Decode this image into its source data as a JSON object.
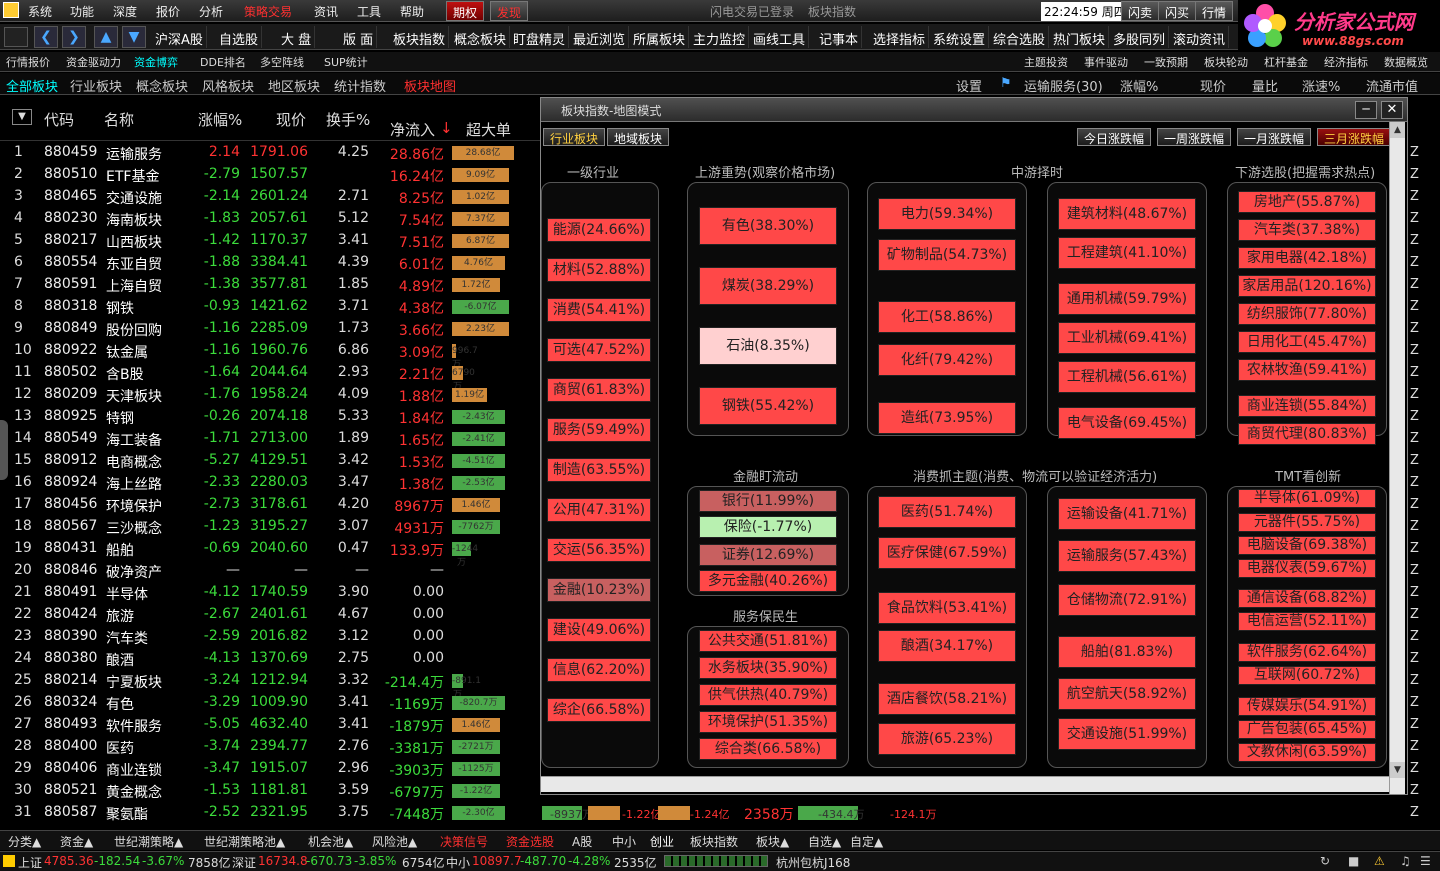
{
  "menu": {
    "items": [
      "系统",
      "功能",
      "深度",
      "报价",
      "分析",
      "策略交易",
      "资讯",
      "工具",
      "帮助"
    ],
    "btn_options": "期权",
    "btn_trade": "发现",
    "status_text": "闪电交易已登录",
    "index_text": "板块指数",
    "clock": "22:24:59 周四",
    "buy": "闪卖",
    "sell": "闪买",
    "quote": "行情"
  },
  "logo": {
    "title": "分析家公式网",
    "url": "www.88gs.com"
  },
  "toolbar1": [
    "沪深A股",
    "自选股",
    "大 盘",
    "版 面",
    "板块指数",
    "概念板块",
    "盯盘精灵",
    "最近浏览",
    "所属板块",
    "主力监控",
    "画线工具",
    "记事本",
    "选择指标",
    "系统设置",
    "综合选股",
    "热门板块",
    "多股同列",
    "滚动资讯"
  ],
  "toolbar2": [
    "行情报价",
    "资金驱动力",
    "资金博弈",
    "DDE排名",
    "多空阵线",
    "SUP统计",
    "主题投资",
    "事件驱动",
    "一致预期",
    "板块轮动",
    "杠杆基金",
    "经济指标",
    "数据概览"
  ],
  "tabs3": {
    "left": [
      "全部板块",
      "行业板块",
      "概念板块",
      "风格板块",
      "地区板块",
      "统计指数",
      "板块地图"
    ],
    "right": [
      "设置",
      "运输服务(30)",
      "涨幅%",
      "现价",
      "量比",
      "涨速%",
      "流通市值"
    ]
  },
  "table": {
    "headers": [
      "代码",
      "名称",
      "涨幅%",
      "现价",
      "换手%",
      "净流入",
      "超大单"
    ],
    "rows": [
      {
        "n": "1",
        "code": "880459",
        "name": "运输服务",
        "chg": "2.14",
        "price": "1791.06",
        "turn": "4.25",
        "flow": "28.86亿",
        "bar": "28.68亿",
        "bv": 0.7,
        "bc": "o"
      },
      {
        "n": "2",
        "code": "880510",
        "name": "ETF基金",
        "chg": "-2.79",
        "price": "1507.57",
        "turn": "",
        "flow": "16.24亿",
        "bar": "9.09亿",
        "bv": 0.65,
        "bc": "o"
      },
      {
        "n": "3",
        "code": "880465",
        "name": "交通设施",
        "chg": "-2.14",
        "price": "2601.24",
        "turn": "2.71",
        "flow": "8.25亿",
        "bar": "1.02亿",
        "bv": 0.65,
        "bc": "o"
      },
      {
        "n": "4",
        "code": "880230",
        "name": "海南板块",
        "chg": "-1.83",
        "price": "2057.61",
        "turn": "5.12",
        "flow": "7.54亿",
        "bar": "7.37亿",
        "bv": 0.65,
        "bc": "o"
      },
      {
        "n": "5",
        "code": "880217",
        "name": "山西板块",
        "chg": "-1.42",
        "price": "1170.37",
        "turn": "3.41",
        "flow": "7.51亿",
        "bar": "6.87亿",
        "bv": 0.65,
        "bc": "o"
      },
      {
        "n": "6",
        "code": "880554",
        "name": "东亚自贸",
        "chg": "-1.88",
        "price": "3384.41",
        "turn": "4.39",
        "flow": "6.01亿",
        "bar": "4.76亿",
        "bv": 0.6,
        "bc": "o"
      },
      {
        "n": "7",
        "code": "880591",
        "name": "上海自贸",
        "chg": "-1.38",
        "price": "3577.81",
        "turn": "1.85",
        "flow": "4.89亿",
        "bar": "1.72亿",
        "bv": 0.55,
        "bc": "o"
      },
      {
        "n": "8",
        "code": "880318",
        "name": "钢铁",
        "chg": "-0.93",
        "price": "1421.62",
        "turn": "3.71",
        "flow": "4.38亿",
        "bar": "-6.07亿",
        "bv": 0.65,
        "bc": "g"
      },
      {
        "n": "9",
        "code": "880849",
        "name": "股份回购",
        "chg": "-1.16",
        "price": "2285.09",
        "turn": "1.73",
        "flow": "3.66亿",
        "bar": "2.23亿",
        "bv": 0.65,
        "bc": "o"
      },
      {
        "n": "10",
        "code": "880922",
        "name": "钛金属",
        "chg": "-1.16",
        "price": "1960.76",
        "turn": "6.86",
        "flow": "3.09亿",
        "bar": "996.7万",
        "bv": 0.03,
        "bc": "o"
      },
      {
        "n": "11",
        "code": "880502",
        "name": "含B股",
        "chg": "-1.64",
        "price": "2044.64",
        "turn": "2.93",
        "flow": "2.21亿",
        "bar": "6790万",
        "bv": 0.12,
        "bc": "o"
      },
      {
        "n": "12",
        "code": "880209",
        "name": "天津板块",
        "chg": "-1.76",
        "price": "1958.24",
        "turn": "4.09",
        "flow": "1.88亿",
        "bar": "1.19亿",
        "bv": 0.4,
        "bc": "o"
      },
      {
        "n": "13",
        "code": "880925",
        "name": "特钢",
        "chg": "-0.26",
        "price": "2074.18",
        "turn": "5.33",
        "flow": "1.84亿",
        "bar": "-2.43亿",
        "bv": 0.6,
        "bc": "g"
      },
      {
        "n": "14",
        "code": "880549",
        "name": "海工装备",
        "chg": "-1.71",
        "price": "2713.00",
        "turn": "1.89",
        "flow": "1.65亿",
        "bar": "-2.41亿",
        "bv": 0.6,
        "bc": "g"
      },
      {
        "n": "15",
        "code": "880912",
        "name": "电商概念",
        "chg": "-5.27",
        "price": "4129.51",
        "turn": "3.42",
        "flow": "1.53亿",
        "bar": "-4.51亿",
        "bv": 0.6,
        "bc": "g"
      },
      {
        "n": "16",
        "code": "880924",
        "name": "海上丝路",
        "chg": "-2.33",
        "price": "2280.03",
        "turn": "3.47",
        "flow": "1.38亿",
        "bar": "-2.53亿",
        "bv": 0.6,
        "bc": "g"
      },
      {
        "n": "17",
        "code": "880456",
        "name": "环境保护",
        "chg": "-2.73",
        "price": "3178.61",
        "turn": "4.20",
        "flow": "8967万",
        "bar": "1.46亿",
        "bv": 0.55,
        "bc": "o"
      },
      {
        "n": "18",
        "code": "880567",
        "name": "三沙概念",
        "chg": "-1.23",
        "price": "3195.27",
        "turn": "3.07",
        "flow": "4931万",
        "bar": "-7762万",
        "bv": 0.55,
        "bc": "g"
      },
      {
        "n": "19",
        "code": "880431",
        "name": "船舶",
        "chg": "-0.69",
        "price": "2040.60",
        "turn": "0.47",
        "flow": "133.9万",
        "bar": "-1244万",
        "bv": 0.22,
        "bc": "g"
      },
      {
        "n": "20",
        "code": "880846",
        "name": "破净资产",
        "chg": "—",
        "price": "—",
        "turn": "—",
        "flow": "—",
        "bar": "",
        "bv": 0,
        "bc": "o"
      },
      {
        "n": "21",
        "code": "880491",
        "name": "半导体",
        "chg": "-4.12",
        "price": "1740.59",
        "turn": "3.90",
        "flow": "0.00",
        "bar": "",
        "bv": 0,
        "bc": "o"
      },
      {
        "n": "22",
        "code": "880424",
        "name": "旅游",
        "chg": "-2.67",
        "price": "2401.61",
        "turn": "4.67",
        "flow": "0.00",
        "bar": "",
        "bv": 0,
        "bc": "o"
      },
      {
        "n": "23",
        "code": "880390",
        "name": "汽车类",
        "chg": "-2.59",
        "price": "2016.82",
        "turn": "3.12",
        "flow": "0.00",
        "bar": "",
        "bv": 0,
        "bc": "o"
      },
      {
        "n": "24",
        "code": "880380",
        "name": "酿酒",
        "chg": "-4.13",
        "price": "1370.69",
        "turn": "2.75",
        "flow": "0.00",
        "bar": "",
        "bv": 0,
        "bc": "o"
      },
      {
        "n": "25",
        "code": "880214",
        "name": "宁夏板块",
        "chg": "-3.24",
        "price": "1212.94",
        "turn": "3.32",
        "flow": "-214.4万",
        "bar": "-891.1万",
        "bv": 0.12,
        "bc": "g"
      },
      {
        "n": "26",
        "code": "880324",
        "name": "有色",
        "chg": "-3.29",
        "price": "1009.90",
        "turn": "3.41",
        "flow": "-1169万",
        "bar": "-820.7万",
        "bv": 0.6,
        "bc": "g"
      },
      {
        "n": "27",
        "code": "880493",
        "name": "软件服务",
        "chg": "-5.05",
        "price": "4632.40",
        "turn": "3.41",
        "flow": "-1879万",
        "bar": "1.46亿",
        "bv": 0.55,
        "bc": "o"
      },
      {
        "n": "28",
        "code": "880400",
        "name": "医药",
        "chg": "-3.74",
        "price": "2394.77",
        "turn": "2.76",
        "flow": "-3381万",
        "bar": "-2721万",
        "bv": 0.55,
        "bc": "g"
      },
      {
        "n": "29",
        "code": "880406",
        "name": "商业连锁",
        "chg": "-3.47",
        "price": "1915.07",
        "turn": "2.96",
        "flow": "-3903万",
        "bar": "-1125万",
        "bv": 0.55,
        "bc": "g"
      },
      {
        "n": "30",
        "code": "880521",
        "name": "黄金概念",
        "chg": "-1.53",
        "price": "1181.81",
        "turn": "3.59",
        "flow": "-6797万",
        "bar": "-1.22亿",
        "bv": 0.55,
        "bc": "g"
      },
      {
        "n": "31",
        "code": "880587",
        "name": "聚氨酯",
        "chg": "-2.52",
        "price": "2321.95",
        "turn": "3.75",
        "flow": "-7448万",
        "bar": "-2.30亿",
        "bv": 0.6,
        "bc": "g"
      }
    ]
  },
  "extra_row": {
    "v1": "-8937万",
    "v2": "-1.22亿",
    "v3": "-1.24亿",
    "v4": "2358万",
    "v5": "-434.4万",
    "v6": "-124.1万"
  },
  "popup": {
    "title": "板块指数-地图模式",
    "tab_industry": "行业板块",
    "tab_region": "地域板块",
    "range_btns": [
      "今日涨跌幅",
      "一周涨跌幅",
      "一月涨跌幅",
      "三月涨跌幅"
    ],
    "groups": {
      "level1": {
        "label": "一级行业",
        "tiles": [
          "能源(24.66%)",
          "材料(52.88%)",
          "消费(54.41%)",
          "可选(47.52%)",
          "商贸(61.83%)",
          "服务(59.49%)",
          "制造(63.55%)",
          "公用(47.31%)",
          "交运(56.35%)",
          "金融(10.23%)",
          "建设(49.06%)",
          "信息(62.20%)",
          "综企(66.58%)"
        ]
      },
      "upstream": {
        "label": "上游重势(观察价格市场)",
        "tiles": [
          "有色(38.30%)",
          "煤炭(38.29%)",
          "石油(8.35%)",
          "钢铁(55.42%)"
        ]
      },
      "mid_label": "中游择时",
      "mid1": {
        "tiles": [
          "电力(59.34%)",
          "矿物制品(54.73%)",
          "化工(58.86%)",
          "化纤(79.42%)",
          "造纸(73.95%)"
        ]
      },
      "mid2": {
        "tiles": [
          "建筑材料(48.67%)",
          "工程建筑(41.10%)",
          "通用机械(59.79%)",
          "工业机械(69.41%)",
          "工程机械(56.61%)",
          "电气设备(69.45%)"
        ]
      },
      "downstream": {
        "label": "下游选股(把握需求热点)",
        "tiles": [
          "房地产(55.87%)",
          "汽车类(37.38%)",
          "家用电器(42.18%)",
          "家居用品(120.16%)",
          "纺织服饰(77.80%)",
          "日用化工(45.47%)",
          "农林牧渔(59.41%)",
          "商业连锁(55.84%)",
          "商贸代理(80.83%)"
        ]
      },
      "finance": {
        "label": "金融盯流动",
        "tiles": [
          "银行(11.99%)",
          "保险(-1.77%)",
          "证券(12.69%)",
          "多元金融(40.26%)"
        ]
      },
      "service": {
        "label": "服务保民生",
        "tiles": [
          "公共交通(51.81%)",
          "水务板块(35.90%)",
          "供气供热(40.79%)",
          "环境保护(51.35%)",
          "综合类(66.58%)"
        ]
      },
      "consumer_label": "消费抓主题(消费、物流可以验证经济活力)",
      "cons1": {
        "tiles": [
          "医药(51.74%)",
          "医疗保健(67.59%)",
          "食品饮料(53.41%)",
          "酿酒(34.17%)",
          "酒店餐饮(58.21%)",
          "旅游(65.23%)"
        ]
      },
      "cons2": {
        "tiles": [
          "运输设备(41.71%)",
          "运输服务(57.43%)",
          "仓储物流(72.91%)",
          "船舶(81.83%)",
          "航空航天(58.92%)",
          "交通设施(51.99%)"
        ]
      },
      "tmt": {
        "label": "TMT看创新",
        "tiles": [
          "半导体(61.09%)",
          "元器件(55.75%)",
          "电脑设备(69.38%)",
          "电器仪表(59.67%)",
          "通信设备(68.82%)",
          "电信运营(52.11%)",
          "软件服务(62.64%)",
          "互联网(60.72%)",
          "传媒娱乐(54.91%)",
          "广告包装(65.45%)",
          "文教休闲(63.59%)"
        ]
      }
    }
  },
  "bottom_tabs": [
    "分类▲",
    "资金▲",
    "世纪潮策略▲",
    "世纪潮策略池▲",
    "机会池▲",
    "风险池▲",
    "决策信号",
    "资金选股",
    "A股",
    "中小",
    "创业",
    "板块指数",
    "板块▲",
    "自选▲",
    "自定▲"
  ],
  "status": {
    "sh_label": "上证",
    "sh_val": "4785.36",
    "sh_chg": "-182.54",
    "sh_pct": "-3.67%",
    "sh_amt": "7858亿",
    "sz_label": "深证",
    "sz_val": "16734.8",
    "sz_chg": "-670.73",
    "sz_pct": "-3.85%",
    "sz_amt": "6754亿",
    "zx_label": "中小",
    "zx_val": "10897.7",
    "zx_chg": "-487.70",
    "zx_pct": "-4.28%",
    "zx_amt": "2535亿",
    "city": "杭州包杭J168"
  },
  "colors": {
    "up": "#ff3232",
    "down": "#3cdc3c",
    "tile_red": "#ff4848",
    "tile_pink": "#ffd0d0",
    "tile_green": "#b8f0b0",
    "tile_mid": "#c86060",
    "bar_orange": "#d08a3a",
    "bar_green": "#4aa84a"
  }
}
